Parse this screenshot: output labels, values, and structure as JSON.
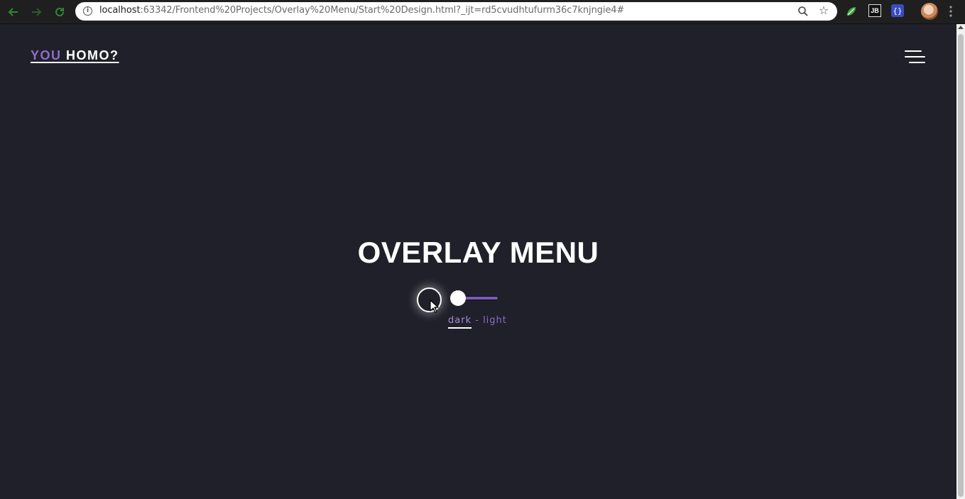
{
  "browser": {
    "url_host": "localhost",
    "url_rest": ":63342/Frontend%20Projects/Overlay%20Menu/Start%20Design.html?_ijt=rd5cvudhtufurm36c7knjngie4#",
    "info_glyph": "i",
    "back_icon": "arrow-left-icon",
    "forward_icon": "arrow-right-icon",
    "reload_icon": "reload-icon",
    "ext_jb_label": "JB",
    "ext_braces_label": "{}"
  },
  "header": {
    "logo_you": "YOU",
    "logo_rest": " HOMO?",
    "menu_icon": "hamburger-menu-icon"
  },
  "hero": {
    "title": "OVERLAY MENU"
  },
  "theme_switch": {
    "dark_label": "dark",
    "separator": " - ",
    "light_label": "light",
    "state": "dark"
  },
  "colors": {
    "background": "#20202a",
    "accent": "#8e6cc9",
    "text": "#ffffff"
  }
}
